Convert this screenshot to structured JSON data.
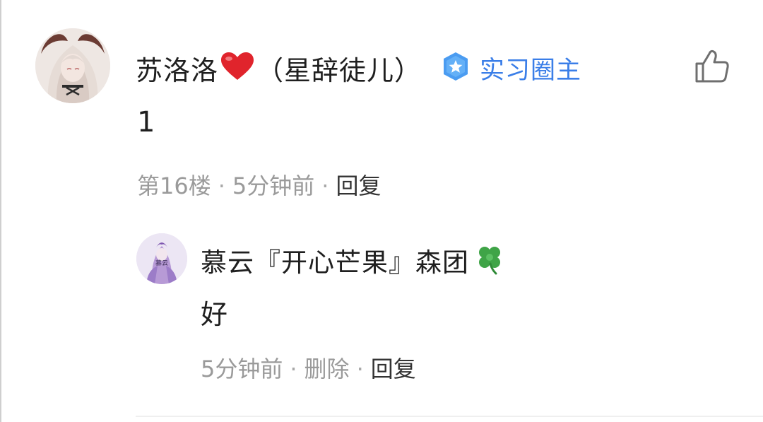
{
  "comment": {
    "author": {
      "name_prefix": "苏洛洛",
      "name_suffix": "（星辞徒儿）",
      "heart_icon": "heart-icon"
    },
    "badge": {
      "label": "实习圈主",
      "icon": "star-shield-icon",
      "color": "#3a7ee8"
    },
    "like_icon": "thumbs-up-icon",
    "content": "1",
    "meta": {
      "floor": "第16楼",
      "sep1": "·",
      "time": "5分钟前",
      "sep2": "·",
      "reply": "回复"
    },
    "reply": {
      "author": {
        "name": "慕云『开心芒果』森团",
        "clover_icon": "four-leaf-clover-icon"
      },
      "content": "好",
      "meta": {
        "time": "5分钟前",
        "sep1": "·",
        "delete": "删除",
        "sep2": "·",
        "reply": "回复"
      }
    }
  }
}
